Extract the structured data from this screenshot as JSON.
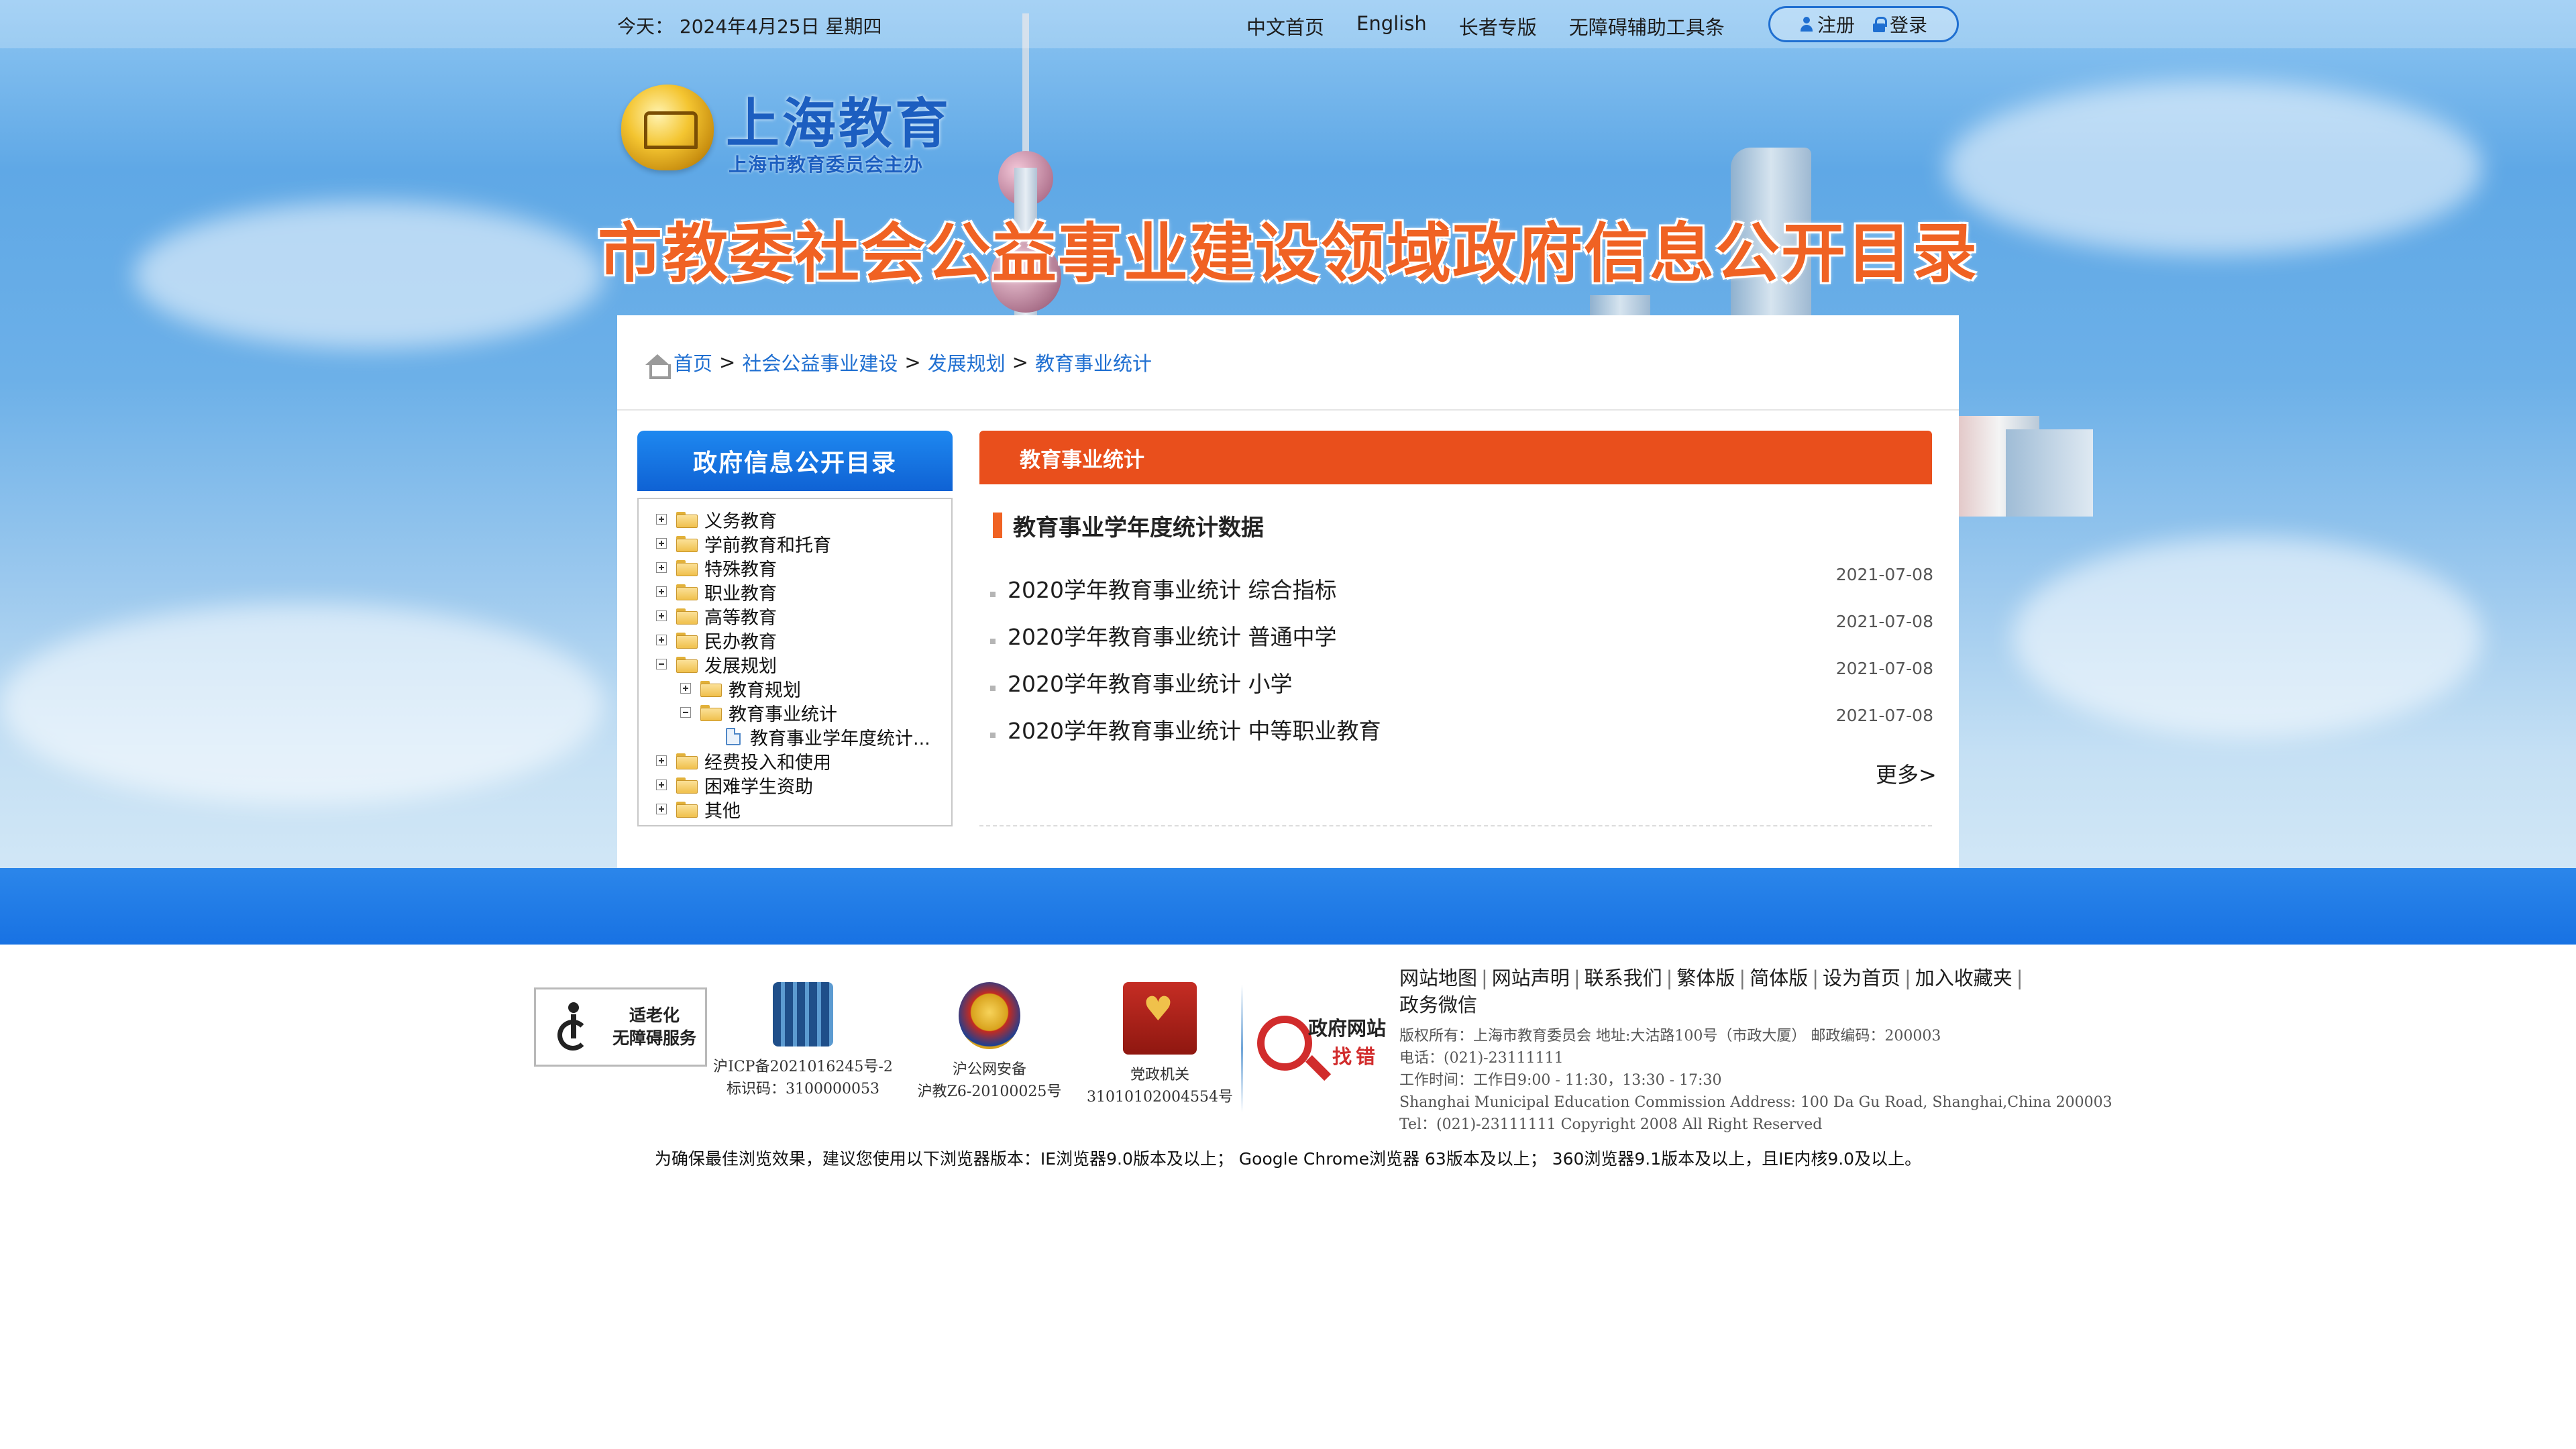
{
  "topbar": {
    "date": "今天： 2024年4月25日 星期四",
    "nav": [
      "中文首页",
      "English",
      "长者专版",
      "无障碍辅助工具条"
    ],
    "register": "注册",
    "login": "登录"
  },
  "logo": {
    "title": "上海教育",
    "subtitle": "上海市教育委员会主办"
  },
  "banner": {
    "title": "市教委社会公益事业建设领域政府信息公开目录"
  },
  "breadcrumb": [
    "首页",
    "社会公益事业建设",
    "发展规划",
    "教育事业统计"
  ],
  "sidebar": {
    "header": "政府信息公开目录",
    "tree": [
      {
        "label": "义务教育",
        "toggle": "+"
      },
      {
        "label": "学前教育和托育",
        "toggle": "+"
      },
      {
        "label": "特殊教育",
        "toggle": "+"
      },
      {
        "label": "职业教育",
        "toggle": "+"
      },
      {
        "label": "高等教育",
        "toggle": "+"
      },
      {
        "label": "民办教育",
        "toggle": "+"
      },
      {
        "label": "发展规划",
        "toggle": "-"
      },
      {
        "label": "教育规划",
        "toggle": "+"
      },
      {
        "label": "教育事业统计",
        "toggle": "-"
      },
      {
        "label": "教育事业学年度统计..."
      },
      {
        "label": "经费投入和使用",
        "toggle": "+"
      },
      {
        "label": "困难学生资助",
        "toggle": "+"
      },
      {
        "label": "其他",
        "toggle": "+"
      }
    ]
  },
  "content": {
    "header": "教育事业统计",
    "section_title": "教育事业学年度统计数据",
    "items": [
      {
        "title": "2020学年教育事业统计 综合指标",
        "date": "2021-07-08"
      },
      {
        "title": "2020学年教育事业统计 普通中学",
        "date": "2021-07-08"
      },
      {
        "title": "2020学年教育事业统计 小学",
        "date": "2021-07-08"
      },
      {
        "title": "2020学年教育事业统计 中等职业教育",
        "date": "2021-07-08"
      }
    ],
    "more": "更多>"
  },
  "footer": {
    "accessibility": {
      "line1": "适老化",
      "line2": "无障碍服务"
    },
    "icp": {
      "line1": "沪ICP备2021016245号-2",
      "line2": "标识码：3100000053"
    },
    "police": {
      "line1": "沪公网安备",
      "line2": "沪教Z6-20100025号"
    },
    "party": {
      "line1": "党政机关",
      "line2": "31010102004554号"
    },
    "error_badge": {
      "line1": "政府网站",
      "line2": "找错"
    },
    "links": [
      "网站地图",
      "网站声明",
      "联系我们",
      "繁体版",
      "简体版",
      "设为首页",
      "加入收藏夹",
      "政务微信"
    ],
    "info": [
      "版权所有：上海市教育委员会 地址:大沽路100号（市政大厦） 邮政编码：200003",
      "电话：(021)-23111111",
      "工作时间：工作日9:00 - 11:30，13:30 - 17:30",
      "Shanghai Municipal Education Commission Address: 100 Da Gu Road, Shanghai,China 200003",
      "Tel：(021)-23111111 Copyright 2008 All Right Reserved"
    ],
    "browser_note": "为确保最佳浏览效果，建议您使用以下浏览器版本：IE浏览器9.0版本及以上； Google Chrome浏览器 63版本及以上； 360浏览器9.1版本及以上，且IE内核9.0及以上。"
  }
}
